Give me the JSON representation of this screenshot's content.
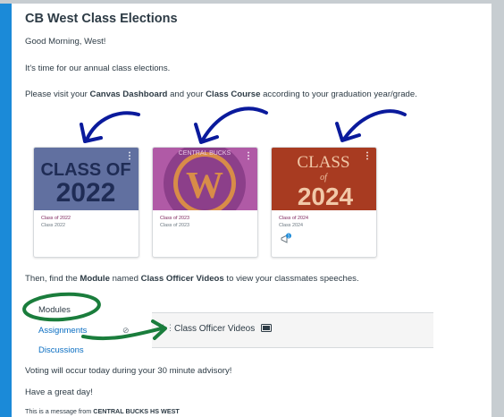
{
  "announcement": {
    "title": "CB West Class Elections",
    "greeting": "Good Morning, West!",
    "line_intro": "It's time for our annual class elections.",
    "line_visit": {
      "pre": "Please visit your ",
      "link1": "Canvas Dashboard",
      "mid": " and your ",
      "link2": "Class Course",
      "post": " according to your graduation year/grade."
    },
    "line_module": {
      "pre": "Then, find the ",
      "b1": "Module",
      "mid": " named ",
      "b2": "Class Officer Videos",
      "post": " to view your classmates speeches."
    },
    "voting": "Voting will occur today during your 30 minute advisory!",
    "closing": "Have a great day!",
    "footer": {
      "pre": "This is a message from ",
      "sender": "CENTRAL BUCKS HS WEST"
    }
  },
  "cards": [
    {
      "image_text_top": "CLASS OF",
      "image_text_bottom": "2022",
      "name": "Class of 2022",
      "sub": "Class 2022",
      "color": "#5d6f9e"
    },
    {
      "image_text": "W",
      "ring_text": "CENTRAL BUCKS",
      "name": "Class of 2023",
      "sub": "Class of 2023",
      "color": "#6b3a8c"
    },
    {
      "image_text_top": "CLASS",
      "image_text_mid": "of",
      "image_text_bottom": "2024",
      "name": "Class of 2024",
      "sub": "Class 2024",
      "color": "#b54226",
      "badge": "1"
    }
  ],
  "modules_nav": {
    "heading": "Modules",
    "items": [
      "Assignments",
      "Discussions"
    ]
  },
  "module_item": {
    "label": "Class Officer Videos",
    "icon": "video-icon"
  },
  "colors": {
    "accent": "#1b8ad8",
    "annotation": "#0a1a9c",
    "annotation_green": "#1a7d3c",
    "link": "#0a6ec2"
  }
}
